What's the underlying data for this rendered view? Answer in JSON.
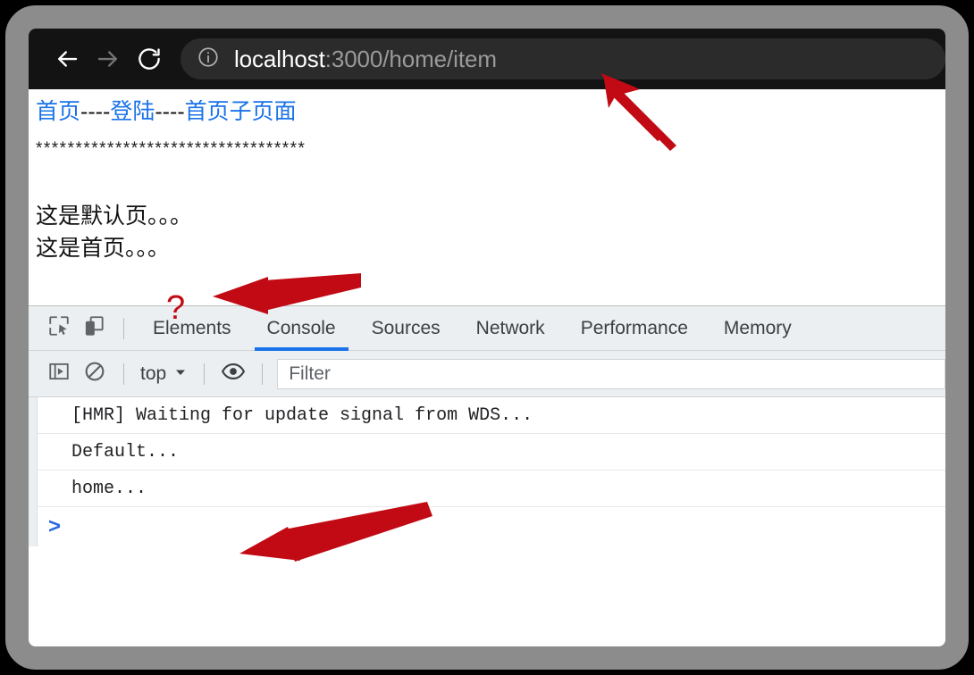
{
  "browser": {
    "back_icon": "arrow-left-icon",
    "forward_icon": "arrow-right-icon",
    "reload_icon": "reload-icon",
    "site_info_icon": "info-circle-icon",
    "url_host": "localhost",
    "url_path": ":3000/home/item",
    "url_full": "localhost:3000/home/item",
    "toolbar_bg": "#131313",
    "omnibox_bg": "#2b2b2b"
  },
  "page": {
    "links": [
      {
        "label": "首页"
      },
      {
        "label": "登陆"
      },
      {
        "label": "首页子页面"
      }
    ],
    "link_separator": "----",
    "link_color": "#1a73e8",
    "divider_line": "**********************************",
    "paragraphs": [
      "这是默认页。。。",
      "这是首页。。。"
    ]
  },
  "devtools": {
    "inspect_icon": "inspect-element-icon",
    "device_toggle_icon": "device-toolbar-icon",
    "tabs": [
      {
        "label": "Elements",
        "active": false
      },
      {
        "label": "Console",
        "active": true
      },
      {
        "label": "Sources",
        "active": false
      },
      {
        "label": "Network",
        "active": false
      },
      {
        "label": "Performance",
        "active": false
      },
      {
        "label": "Memory",
        "active": false
      }
    ],
    "active_tab_color": "#1a73e8",
    "console_toolbar": {
      "sidebar_toggle_icon": "console-sidebar-icon",
      "clear_console_icon": "clear-console-icon",
      "context_label": "top",
      "context_caret_icon": "chevron-down-icon",
      "eye_icon": "live-expression-icon",
      "filter_placeholder": "Filter"
    },
    "console_messages": [
      "[HMR] Waiting for update signal from WDS...",
      "Default...",
      "home..."
    ],
    "prompt_caret": ">",
    "prompt_caret_color": "#2a67e0"
  },
  "annotations": {
    "arrow_color": "#c10a14",
    "question_mark": "?",
    "arrows": [
      {
        "name": "arrow-to-url"
      },
      {
        "name": "arrow-to-question-mark"
      },
      {
        "name": "arrow-to-home-log"
      }
    ]
  }
}
